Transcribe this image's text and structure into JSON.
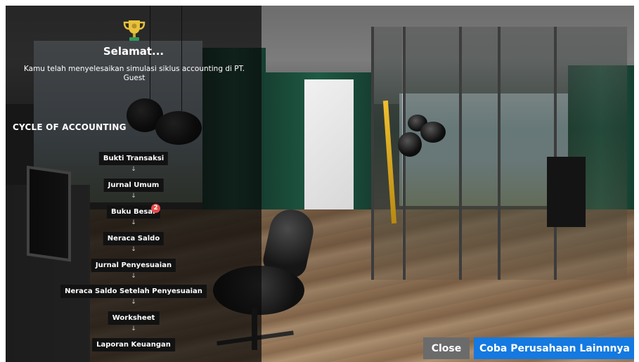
{
  "overlay": {
    "title": "Selamat...",
    "message": "Kamu telah menyelesaikan simulasi siklus accounting di PT. Guest",
    "cycle_title": "CYCLE OF ACCOUNTING",
    "steps": [
      "Bukti Transaksi",
      "Jurnal Umum",
      "Buku Besar",
      "Neraca Saldo",
      "Jurnal Penyesuaian",
      "Neraca Saldo Setelah Penyesuaian",
      "Worksheet",
      "Laporan Keuangan"
    ],
    "arrow": "↓",
    "badge_count": "2"
  },
  "buttons": {
    "close_label": "Close",
    "next_label": "Coba Perusahaan Lainnnya"
  },
  "colors": {
    "next_button": "#1479e0",
    "close_button": "#6b6b6b",
    "badge": "#e94b4b"
  }
}
